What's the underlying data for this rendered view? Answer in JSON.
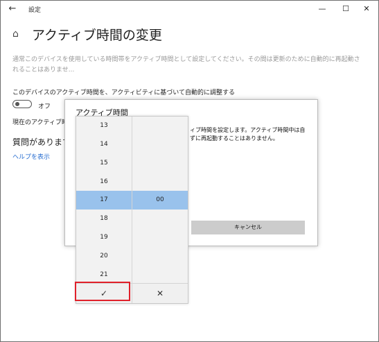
{
  "window": {
    "title": "設定",
    "back_icon": "←",
    "min_icon": "—",
    "max_icon": "☐",
    "close_icon": "✕"
  },
  "page": {
    "home_icon": "⌂",
    "title": "アクティブ時間の変更",
    "description": "通常このデバイスを使用している時間帯をアクティブ時間として設定してください。その間は更新のために自動的に再起動されることはありませ...",
    "auto_adjust_label": "このデバイスのアクティブ時間を、アクティビティに基づいて自動的に調整する",
    "toggle_state": "オフ",
    "current_label": "現在のアクティブ時間",
    "question": "質問があります",
    "help_link": "ヘルプを表示"
  },
  "dialog": {
    "title": "アクティブ時間",
    "body": "ィブ時間を設定します。アクティブ時間中は自ずに再起動することはありません。",
    "cancel_label": "キャンセル"
  },
  "picker": {
    "hours": [
      "13",
      "14",
      "15",
      "16",
      "17",
      "18",
      "19",
      "20",
      "21"
    ],
    "selected_hour": "17",
    "selected_minute": "00",
    "accept_icon": "✓",
    "dismiss_icon": "✕"
  }
}
